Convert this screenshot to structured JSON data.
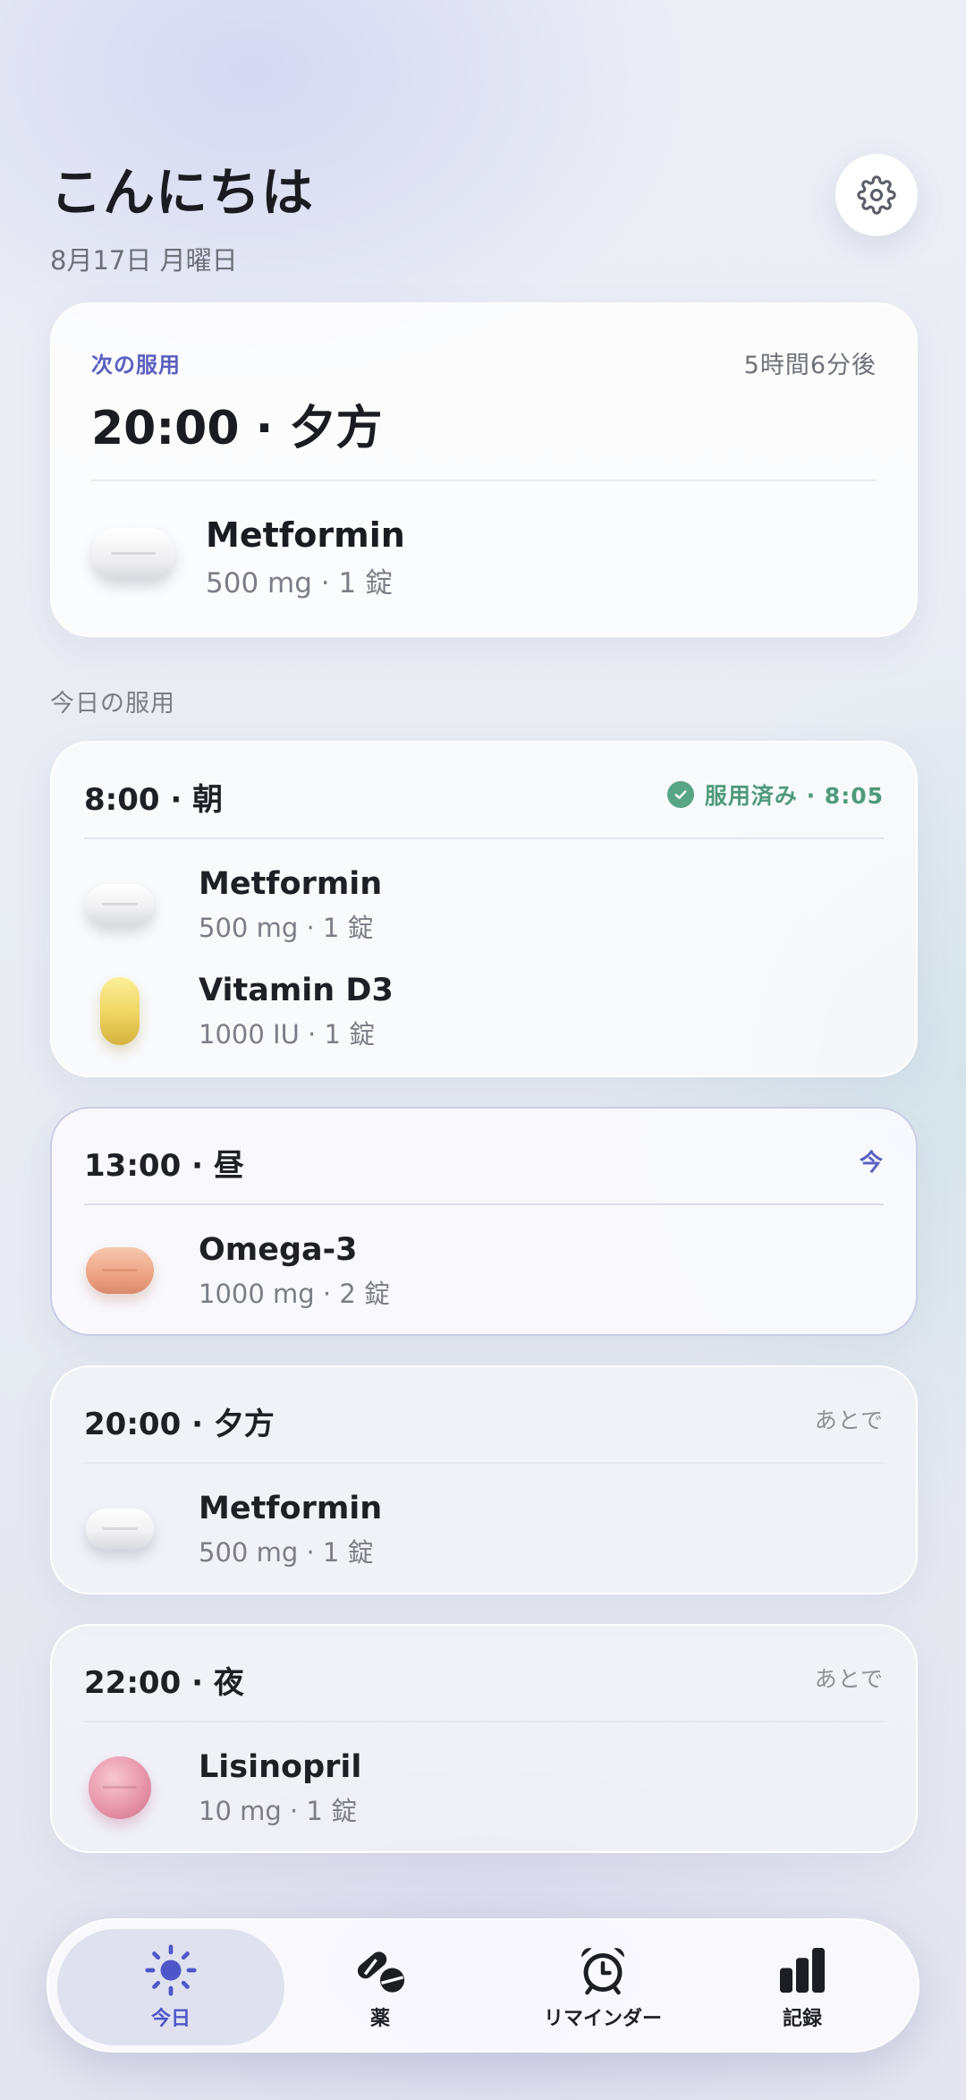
{
  "header": {
    "greeting": "こんにちは",
    "date": "8月17日 月曜日",
    "settings_icon": "gear-icon"
  },
  "next_dose": {
    "label": "次の服用",
    "countdown": "5時間6分後",
    "time": "20:00 · 夕方",
    "medication": {
      "name": "Metformin",
      "dose": "500 mg · 1 錠",
      "pill": "white-oval"
    }
  },
  "schedule_label": "今日の服用",
  "schedule": [
    {
      "time": "8:00 · 朝",
      "status": "服用済み · 8:05",
      "status_type": "taken",
      "meds": [
        {
          "name": "Metformin",
          "dose": "500 mg · 1 錠",
          "pill": "white-oval"
        },
        {
          "name": "Vitamin D3",
          "dose": "1000 IU · 1 錠",
          "pill": "yellow-capsule"
        }
      ]
    },
    {
      "time": "13:00 · 昼",
      "status": "今",
      "status_type": "now",
      "meds": [
        {
          "name": "Omega-3",
          "dose": "1000 mg · 2 錠",
          "pill": "orange-oval"
        }
      ]
    },
    {
      "time": "20:00 · 夕方",
      "status": "あとで",
      "status_type": "later",
      "meds": [
        {
          "name": "Metformin",
          "dose": "500 mg · 1 錠",
          "pill": "white-oval"
        }
      ]
    },
    {
      "time": "22:00 · 夜",
      "status": "あとで",
      "status_type": "later",
      "meds": [
        {
          "name": "Lisinopril",
          "dose": "10 mg · 1 錠",
          "pill": "pink-round"
        }
      ]
    }
  ],
  "tabbar": {
    "tabs": [
      {
        "label": "今日",
        "icon": "sun-icon",
        "active": true
      },
      {
        "label": "薬",
        "icon": "pills-icon",
        "active": false
      },
      {
        "label": "リマインダー",
        "icon": "alarm-clock-icon",
        "active": false
      },
      {
        "label": "記録",
        "icon": "bar-chart-icon",
        "active": false
      }
    ]
  },
  "colors": {
    "accent": "#5a5fbf",
    "taken": "#4f9a7b",
    "text_primary": "#1b1c22",
    "text_secondary": "#7b7e86"
  }
}
